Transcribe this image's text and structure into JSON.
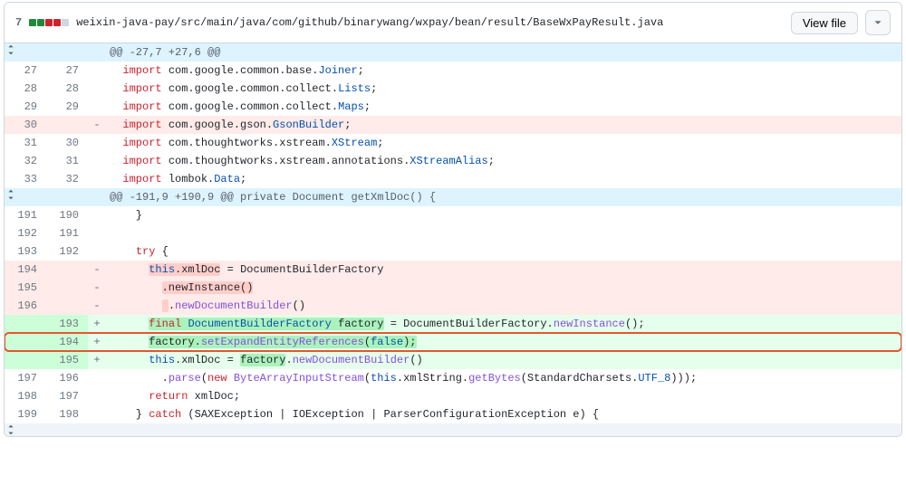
{
  "header": {
    "change_count": "7",
    "diffstat": [
      "add",
      "add",
      "del",
      "del",
      "neu"
    ],
    "file_path": "weixin-java-pay/src/main/java/com/github/binarywang/wxpay/bean/result/BaseWxPayResult.java",
    "view_file": "View file"
  },
  "hunk1": "@@ -27,7 +27,6 @@",
  "hunk2": "@@ -191,9 +190,9 @@ private Document getXmlDoc() {",
  "lines": {
    "l27": {
      "old": "27",
      "new": "27",
      "kw": "import",
      "pkg": " com.google.common.base.",
      "cls": "Joiner",
      ";": ";"
    },
    "l28": {
      "old": "28",
      "new": "28",
      "kw": "import",
      "pkg": " com.google.common.collect.",
      "cls": "Lists",
      ";": ";"
    },
    "l29": {
      "old": "29",
      "new": "29",
      "kw": "import",
      "pkg": " com.google.common.collect.",
      "cls": "Maps",
      ";": ";"
    },
    "l30": {
      "old": "30",
      "new": "",
      "kw": "import",
      "pkg": " com.google.gson.",
      "cls": "GsonBuilder",
      ";": ";"
    },
    "l31": {
      "old": "31",
      "new": "30",
      "kw": "import",
      "pkg": " com.thoughtworks.xstream.",
      "cls": "XStream",
      ";": ";"
    },
    "l32": {
      "old": "32",
      "new": "31",
      "kw": "import",
      "pkg": " com.thoughtworks.xstream.annotations.",
      "cls": "XStreamAlias",
      ";": ";"
    },
    "l33": {
      "old": "33",
      "new": "32",
      "kw": "import",
      "pkg": " lombok.",
      "cls": "Data",
      ";": ";"
    },
    "l191": {
      "old": "191",
      "new": "190",
      "code": "    }"
    },
    "l192": {
      "old": "192",
      "new": "191",
      "code": ""
    },
    "l193": {
      "old": "193",
      "new": "192",
      "kw": "try",
      "rest": " {"
    },
    "l194": {
      "old": "194",
      "pre": "      ",
      "hl": "this.xmlDoc",
      "eq": " = ",
      "rest": "DocumentBuilderFactory"
    },
    "l195": {
      "old": "195",
      "pre": "        ",
      "hl": ".newInstance()"
    },
    "l196": {
      "old": "196",
      "pre": "        ",
      "dot": ".",
      "m": "newDocumentBuilder",
      "paren": "()"
    },
    "l_a193": {
      "new": "193",
      "pre": "      ",
      "kw": "final",
      "sp": " ",
      "type": "DocumentBuilderFactory",
      "sp2": " ",
      "var": "factory",
      "eq": " = ",
      "rhs": "DocumentBuilderFactory",
      "dot": ".",
      "m": "newInstance",
      "paren": "();"
    },
    "l_a194": {
      "new": "194",
      "pre": "      ",
      "obj": "factory",
      "dot": ".",
      "m": "setExpandEntityReferences",
      "open": "(",
      "arg": "false",
      "close": ");"
    },
    "l_a195": {
      "new": "195",
      "pre": "      ",
      "th": "this",
      "prop": ".xmlDoc",
      "eq": " = ",
      "obj": "factory",
      "dot": ".",
      "m": "newDocumentBuilder",
      "paren": "()"
    },
    "l197": {
      "old": "197",
      "new": "196",
      "pre": "        .",
      "m": "parse",
      "open": "(",
      "kw": "new",
      "sp": " ",
      "cls": "ByteArrayInputStream",
      "open2": "(",
      "th": "this",
      "prop": ".xmlString.",
      "m2": "getBytes",
      "open3": "(",
      "arg": "StandardCharsets",
      "dot": ".",
      "c": "UTF_8",
      "close": ")));"
    },
    "l198": {
      "old": "198",
      "new": "197",
      "pre": "      ",
      "kw": "return",
      "rest": " xmlDoc;"
    },
    "l199": {
      "old": "199",
      "new": "198",
      "pre": "    } ",
      "kw": "catch",
      "rest": " (SAXException | IOException | ParserConfigurationException e) {"
    }
  }
}
